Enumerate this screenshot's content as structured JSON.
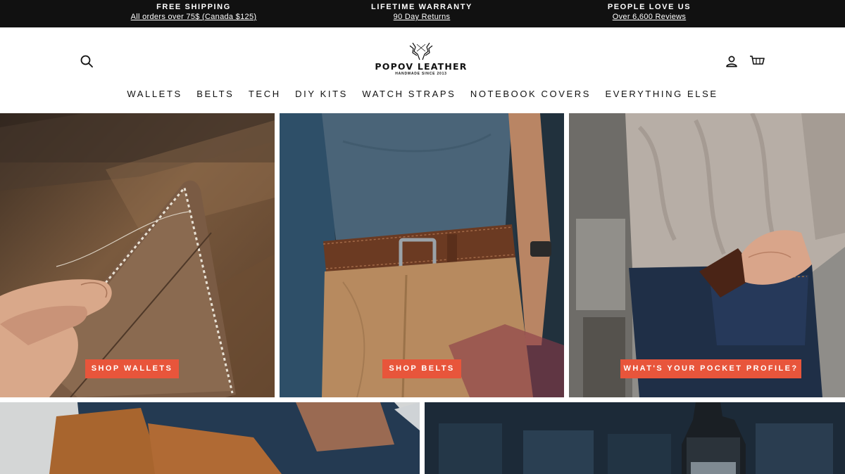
{
  "announcement": {
    "items": [
      {
        "title": "FREE SHIPPING",
        "link": "All orders over 75$ (Canada $125)"
      },
      {
        "title": "LIFETIME WARRANTY",
        "link": "90 Day Returns"
      },
      {
        "title": "PEOPLE LOVE US",
        "link": "Over 6,600 Reviews"
      }
    ]
  },
  "header": {
    "brand": "POPOV LEATHER",
    "tagline": "HANDMADE SINCE 2013",
    "icons": {
      "search": "search-icon",
      "account": "user-icon",
      "cart": "cart-icon"
    }
  },
  "nav": {
    "items": [
      {
        "label": "WALLETS"
      },
      {
        "label": "BELTS"
      },
      {
        "label": "TECH"
      },
      {
        "label": "DIY KITS"
      },
      {
        "label": "WATCH STRAPS"
      },
      {
        "label": "NOTEBOOK COVERS"
      },
      {
        "label": "EVERYTHING ELSE"
      }
    ]
  },
  "tiles": {
    "wallets": {
      "cta": "SHOP WALLETS"
    },
    "belts": {
      "cta": "SHOP BELTS"
    },
    "profile": {
      "cta": "WHAT'S YOUR POCKET PROFILE?"
    }
  },
  "colors": {
    "announcement_bg": "#111111",
    "cta_bg": "#e8553b",
    "text": "#111111"
  }
}
